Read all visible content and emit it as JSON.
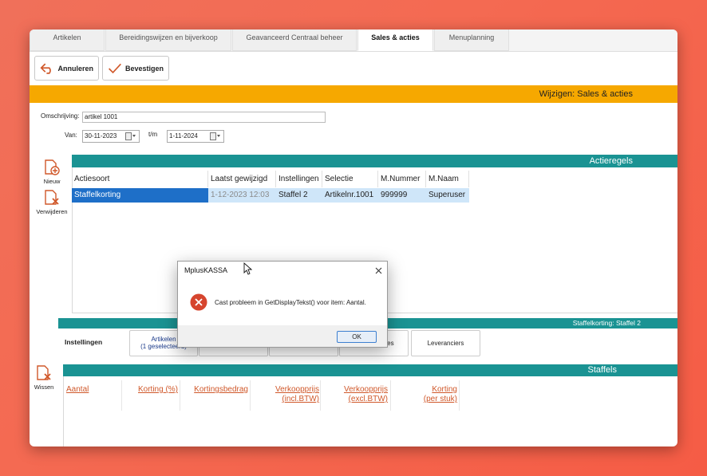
{
  "tabs": [
    "Artikelen",
    "Bereidingswijzen en bijverkoop",
    "Geavanceerd Centraal beheer",
    "Sales & acties",
    "Menuplanning"
  ],
  "toolbar": {
    "cancel_label": "Annuleren",
    "confirm_label": "Bevestigen"
  },
  "header_title": "Wijzigen: Sales & acties",
  "form": {
    "omschrijving_label": "Omschrijving:",
    "omschrijving_value": "artikel 1001",
    "van_label": "Van:",
    "van_value": "30-11-2023",
    "tm_label": "t/m",
    "tm_value": "1-11-2024"
  },
  "actieregels": {
    "title": "Actieregels",
    "new_label": "Nieuw",
    "delete_label": "Verwijderen",
    "columns": [
      "Actiesoort",
      "Laatst gewijzigd",
      "Instellingen",
      "Selectie",
      "M.Nummer",
      "M.Naam"
    ],
    "rows": [
      [
        "Staffelkorting",
        "1-12-2023 12:03",
        "Staffel 2",
        "Artikelnr.1001",
        "999999",
        "Superuser"
      ]
    ]
  },
  "staffel_bar": "Staffelkorting: Staffel 2",
  "subtabs": {
    "instellingen": "Instellingen",
    "artikelen_1": "Artikelen",
    "artikelen_2": "(1 geselecteerd)",
    "hidden_tail": "les",
    "leveranciers": "Leveranciers"
  },
  "wissen_label": "Wissen",
  "staffels": {
    "title": "Staffels",
    "columns": [
      {
        "l1": "Aantal",
        "l2": ""
      },
      {
        "l1": "Korting (%)",
        "l2": ""
      },
      {
        "l1": "Kortingsbedrag",
        "l2": ""
      },
      {
        "l1": "Verkoopprijs",
        "l2": "(incl.BTW)"
      },
      {
        "l1": "Verkoopprijs",
        "l2": "(excl.BTW)"
      },
      {
        "l1": "Korting",
        "l2": "(per stuk)"
      }
    ]
  },
  "dialog": {
    "title": "MplusKASSA",
    "message": "Cast probleem in GetDisplayTekst() voor item: Aantal.",
    "ok_label": "OK"
  },
  "colors": {
    "accent_orange": "#f6a800",
    "teal": "#1a9393",
    "selection_blue": "#1e6fc8",
    "link_orange": "#d0582a"
  }
}
